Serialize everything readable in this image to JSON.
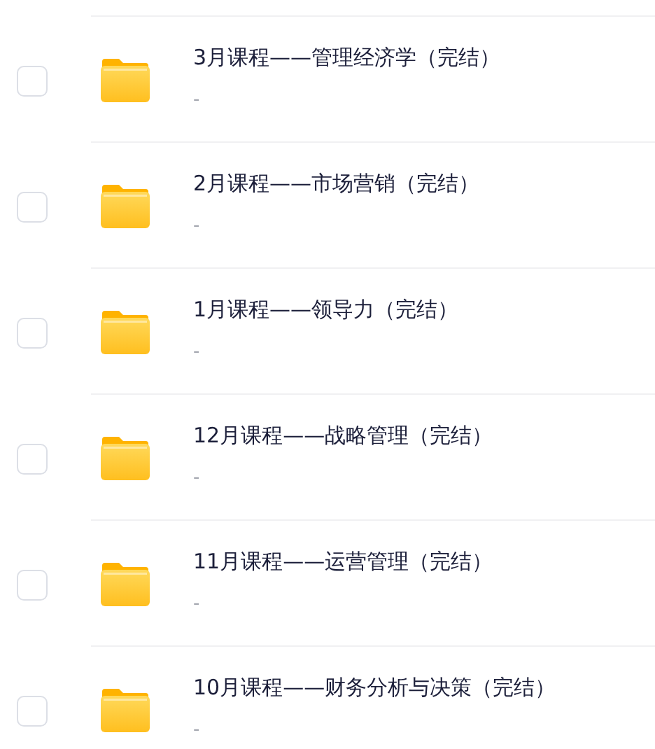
{
  "items": [
    {
      "title": "3月课程——管理经济学（完结）",
      "subtitle": "-",
      "checked": false
    },
    {
      "title": "2月课程——市场营销（完结）",
      "subtitle": "-",
      "checked": false
    },
    {
      "title": "1月课程——领导力（完结）",
      "subtitle": "-",
      "checked": false
    },
    {
      "title": "12月课程——战略管理（完结）",
      "subtitle": "-",
      "checked": false
    },
    {
      "title": "11月课程——运营管理（完结）",
      "subtitle": "-",
      "checked": false
    },
    {
      "title": "10月课程——财务分析与决策（完结）",
      "subtitle": "-",
      "checked": false
    }
  ]
}
